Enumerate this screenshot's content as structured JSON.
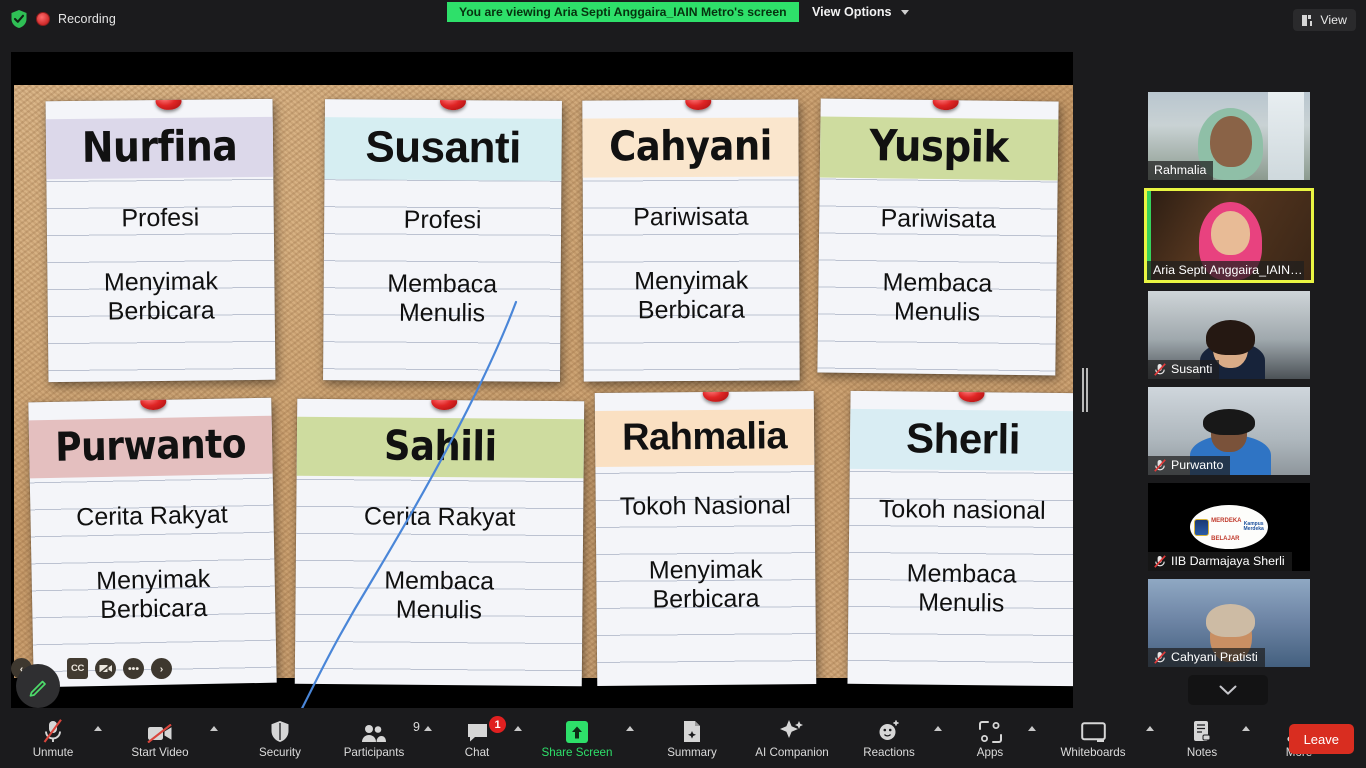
{
  "topbar": {
    "shield_icon": "shield-check-icon",
    "recording_icon": "recording-indicator-icon",
    "recording_label": "Recording",
    "share_banner": "You are viewing Aria Septi Anggaira_IAIN Metro's screen",
    "view_options_label": "View Options",
    "view_button_label": "View"
  },
  "shared_screen": {
    "notes": [
      {
        "name": "Nurfina",
        "line1": "Profesi",
        "line2": "Menyimak",
        "line3": "Berbicara",
        "band_color": "#dcd8ea",
        "name_style": "cond"
      },
      {
        "name": "Susanti",
        "line1": "Profesi",
        "line2": "Membaca",
        "line3": "Menulis",
        "band_color": "#d6eef2",
        "name_style": "bold"
      },
      {
        "name": "Cahyani",
        "line1": "Pariwisata",
        "line2": "Menyimak",
        "line3": "Berbicara",
        "band_color": "#fae6cd",
        "name_style": "cond"
      },
      {
        "name": "Yuspik",
        "line1": "Pariwisata",
        "line2": "Membaca",
        "line3": "Menulis",
        "band_color": "#cedc9f",
        "name_style": "cond"
      },
      {
        "name": "Purwanto",
        "line1": "Cerita Rakyat",
        "line2": "Menyimak",
        "line3": "Berbicara",
        "band_color": "#e4bfbf",
        "name_style": "cond"
      },
      {
        "name": "Sahili",
        "line1": "Cerita Rakyat",
        "line2": "Membaca",
        "line3": "Menulis",
        "band_color": "#cedc9f",
        "name_style": "cond"
      },
      {
        "name": "Rahmalia",
        "line1": "Tokoh Nasional",
        "line2": "Menyimak",
        "line3": "Berbicara",
        "band_color": "#fae0c2",
        "name_style": "bold"
      },
      {
        "name": "Sherli",
        "line1": "Tokoh nasional",
        "line2": "Membaca",
        "line3": "Menulis",
        "band_color": "#d9edf3",
        "name_style": "bold"
      }
    ],
    "annotation_color": "#4a86d8",
    "float_toolbar": [
      "back-arrow-icon",
      "pen-icon",
      "closed-caption-icon",
      "video-off-icon",
      "more-dots-icon",
      "forward-arrow-icon"
    ],
    "closed_caption_label": "CC"
  },
  "thumbnails": [
    {
      "label": "Rahmalia",
      "muted": false,
      "active": false,
      "speaking": false
    },
    {
      "label": "Aria Septi Anggaira_IAIN…",
      "muted": false,
      "active": true,
      "speaking": true
    },
    {
      "label": "Susanti",
      "muted": true,
      "active": false,
      "speaking": false
    },
    {
      "label": "Purwanto",
      "muted": true,
      "active": false,
      "speaking": false
    },
    {
      "label": "IIB Darmajaya Sherli",
      "muted": true,
      "active": false,
      "speaking": false
    },
    {
      "label": "Cahyani Pratisti",
      "muted": true,
      "active": false,
      "speaking": false
    }
  ],
  "thumbnail_logo": {
    "top_text": "MERDEKA",
    "mid_text": "BELAJAR",
    "right_text": "Kampus Merdeka"
  },
  "strip_scroll_icon": "chevron-down-icon",
  "bottombar": {
    "items": [
      {
        "label": "Unmute",
        "icon": "microphone-muted-icon",
        "caret": true,
        "badge": null,
        "count": null,
        "green": false
      },
      {
        "label": "Start Video",
        "icon": "video-off-icon",
        "caret": true,
        "badge": null,
        "count": null,
        "green": false
      },
      {
        "label": "Security",
        "icon": "shield-icon",
        "caret": false,
        "badge": null,
        "count": null,
        "green": false
      },
      {
        "label": "Participants",
        "icon": "participants-icon",
        "caret": true,
        "badge": null,
        "count": "9",
        "green": false
      },
      {
        "label": "Chat",
        "icon": "chat-bubble-icon",
        "caret": true,
        "badge": "1",
        "count": null,
        "green": false
      },
      {
        "label": "Share Screen",
        "icon": "share-screen-icon",
        "caret": true,
        "badge": null,
        "count": null,
        "green": true
      },
      {
        "label": "Summary",
        "icon": "summary-doc-icon",
        "caret": false,
        "badge": null,
        "count": null,
        "green": false
      },
      {
        "label": "AI Companion",
        "icon": "sparkle-icon",
        "caret": false,
        "badge": null,
        "count": null,
        "green": false
      },
      {
        "label": "Reactions",
        "icon": "emoji-plus-icon",
        "caret": true,
        "badge": null,
        "count": null,
        "green": false
      },
      {
        "label": "Apps",
        "icon": "apps-icon",
        "caret": true,
        "badge": null,
        "count": null,
        "green": false
      },
      {
        "label": "Whiteboards",
        "icon": "whiteboard-icon",
        "caret": true,
        "badge": null,
        "count": null,
        "green": false
      },
      {
        "label": "Notes",
        "icon": "notes-icon",
        "caret": true,
        "badge": null,
        "count": null,
        "green": false
      },
      {
        "label": "More",
        "icon": "more-dots-icon",
        "caret": false,
        "badge": null,
        "count": null,
        "green": false
      }
    ],
    "leave_label": "Leave"
  },
  "colors": {
    "accent_green": "#2ee06a",
    "leave_red": "#d92d20",
    "active_border": "#e9f542"
  }
}
